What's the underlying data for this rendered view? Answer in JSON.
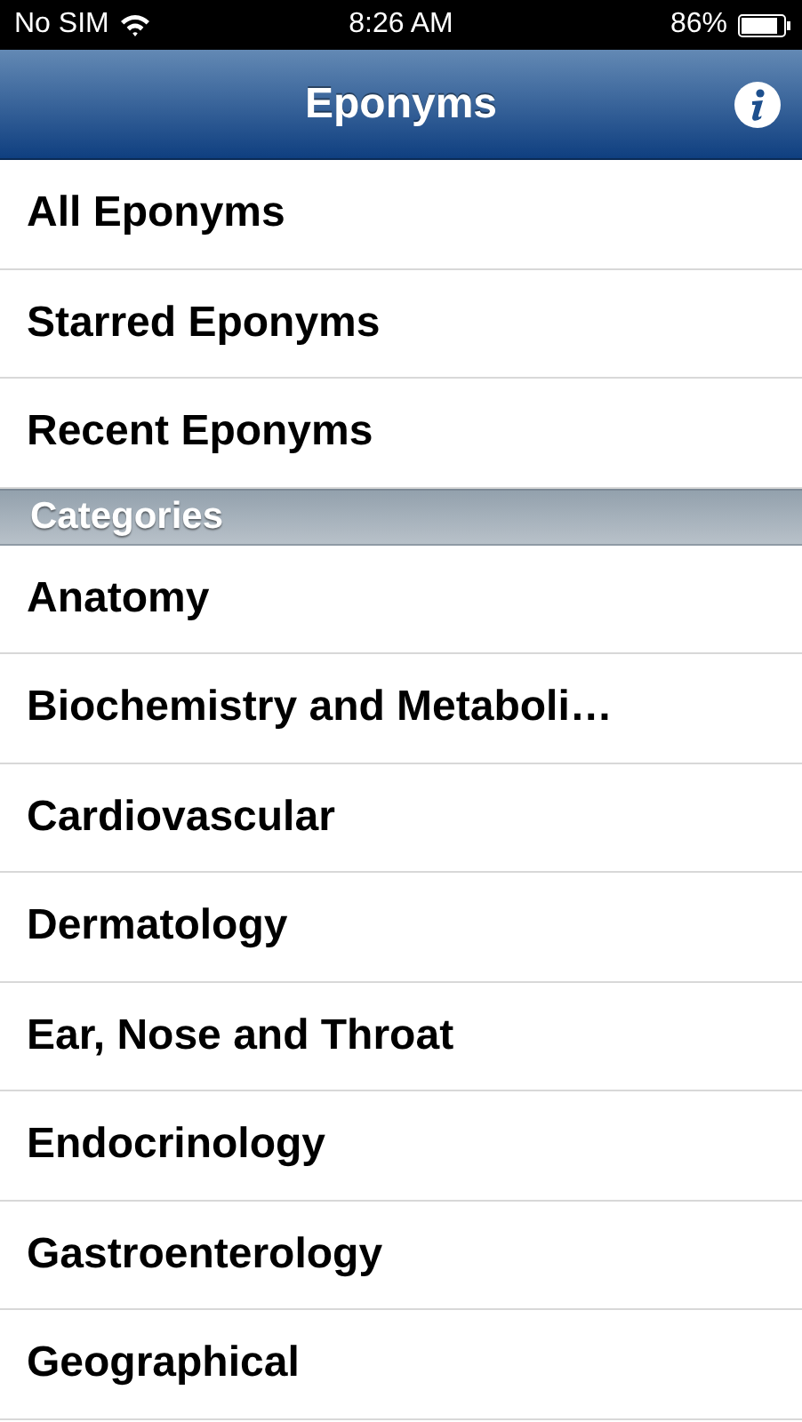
{
  "status_bar": {
    "carrier": "No SIM",
    "time": "8:26 AM",
    "battery": "86%"
  },
  "nav_bar": {
    "title": "Eponyms"
  },
  "main_items": [
    {
      "label": "All Eponyms"
    },
    {
      "label": "Starred Eponyms"
    },
    {
      "label": "Recent Eponyms"
    }
  ],
  "section_header": "Categories",
  "categories": [
    {
      "label": "Anatomy"
    },
    {
      "label": "Biochemistry and Metaboli…"
    },
    {
      "label": "Cardiovascular"
    },
    {
      "label": "Dermatology"
    },
    {
      "label": "Ear, Nose and Throat"
    },
    {
      "label": "Endocrinology"
    },
    {
      "label": "Gastroenterology"
    },
    {
      "label": "Geographical"
    }
  ]
}
